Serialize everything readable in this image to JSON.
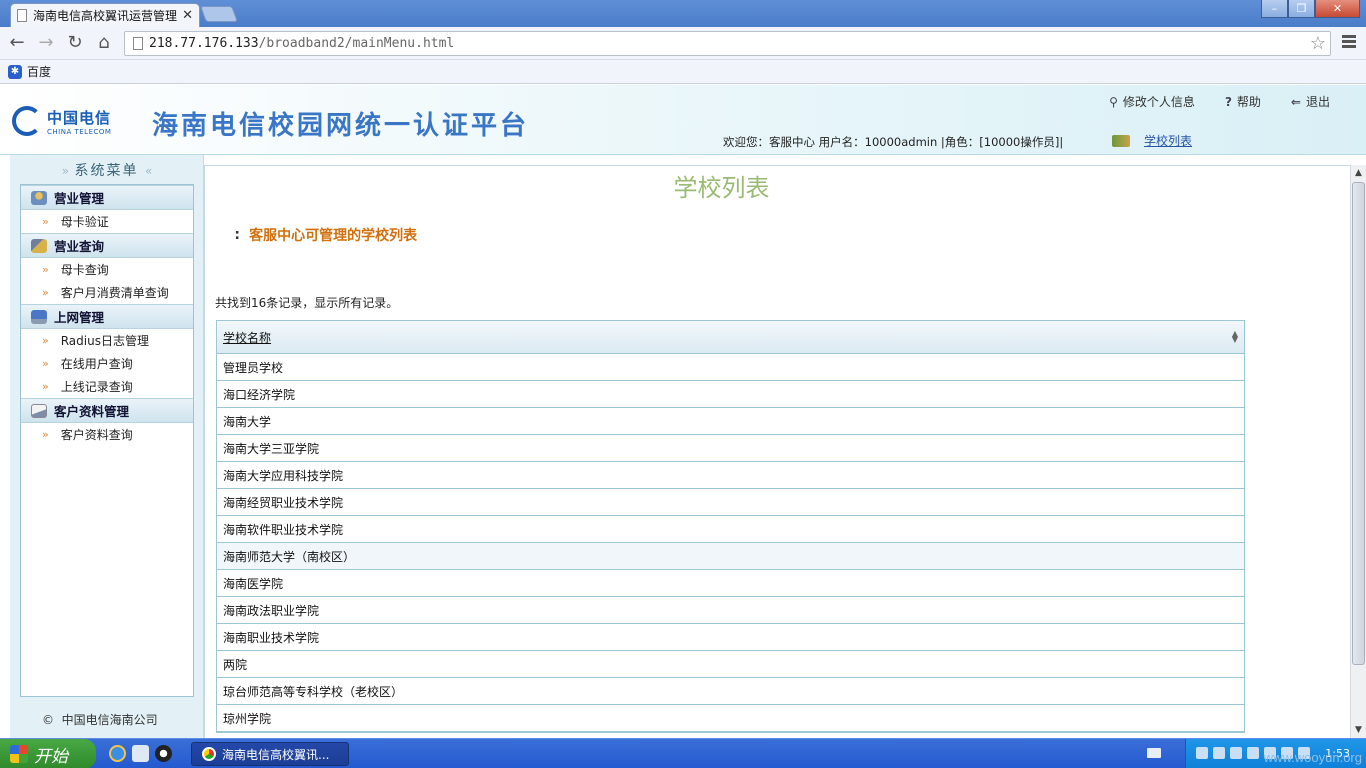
{
  "browser": {
    "tab_title": "海南电信高校翼讯运营管理",
    "url_host": "218.77.176.133",
    "url_path": "/broadband2/mainMenu.html",
    "bookmark": "百度"
  },
  "header": {
    "brand_cn": "中国电信",
    "brand_en": "CHINA TELECOM",
    "platform_title": "海南电信校园网统一认证平台",
    "links": {
      "profile": "修改个人信息",
      "help": "帮助",
      "logout": "退出"
    },
    "user_info": "欢迎您：客服中心 用户名：10000admin  |角色：[10000操作员]|",
    "school_list_link": "学校列表"
  },
  "sidebar": {
    "title": "系统菜单",
    "groups": [
      {
        "label": "营业管理",
        "items": [
          "母卡验证"
        ]
      },
      {
        "label": "营业查询",
        "items": [
          "母卡查询",
          "客户月消费清单查询"
        ]
      },
      {
        "label": "上网管理",
        "items": [
          "Radius日志管理",
          "在线用户查询",
          "上线记录查询"
        ]
      },
      {
        "label": "客户资料管理",
        "items": [
          "客户资料查询"
        ]
      }
    ],
    "copyright": "中国电信海南公司"
  },
  "main": {
    "page_title": "学校列表",
    "subtitle": "客服中心可管理的学校列表",
    "records_found": "共找到16条记录，显示所有记录。",
    "column_header": "学校名称",
    "rows": [
      "管理员学校",
      "海口经济学院",
      "海南大学",
      "海南大学三亚学院",
      "海南大学应用科技学院",
      "海南经贸职业技术学院",
      "海南软件职业技术学院",
      "海南师范大学（南校区）",
      "海南医学院",
      "海南政法职业学院",
      "海南职业技术学院",
      "两院",
      "琼台师范高等专科学校（老校区）",
      "琼州学院"
    ],
    "highlighted_row": 7
  },
  "taskbar": {
    "start_label": "开始",
    "task_label": "海南电信高校翼讯...",
    "clock": "1:53",
    "watermark": "www.wooyun.org"
  },
  "colors": {
    "title_green": "#9aba72",
    "subtitle_orange": "#d0700f",
    "brand_blue": "#1a5eb8"
  }
}
